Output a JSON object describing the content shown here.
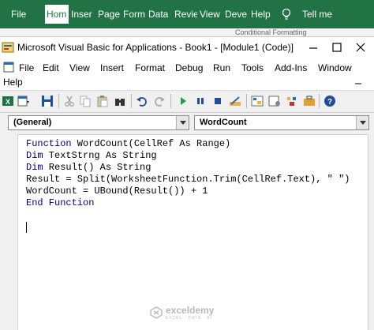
{
  "excel": {
    "tabs": [
      "File",
      "Hom",
      "Inser",
      "Page",
      "Form",
      "Data",
      "Revie",
      "View",
      "Deve",
      "Help"
    ],
    "active_tab_index": 1,
    "tell_me": "Tell me",
    "ribbon_peek": "Conditional Formatting",
    "accent": "#217346"
  },
  "vba": {
    "title": "Microsoft Visual Basic for Applications - Book1 - [Module1 (Code)]",
    "menu_row1": [
      "File",
      "Edit",
      "View",
      "Insert",
      "Format",
      "Debug",
      "Run",
      "Tools",
      "Add-Ins",
      "Window"
    ],
    "menu_row2": [
      "Help"
    ],
    "toolbar_icons": [
      "view-excel-icon",
      "insert-module-icon",
      "save-icon",
      "cut-icon",
      "copy-icon",
      "paste-icon",
      "find-icon",
      "undo-icon",
      "redo-icon",
      "run-icon",
      "break-icon",
      "reset-icon",
      "design-mode-icon",
      "project-explorer-icon",
      "properties-icon",
      "object-browser-icon",
      "toolbox-icon",
      "help-icon"
    ],
    "object_combo": "(General)",
    "procedure_combo": "WordCount",
    "code": [
      {
        "kw": "Function",
        "rest": " WordCount(CellRef As Range)"
      },
      {
        "kw": "Dim",
        "rest": " TextStrng As String"
      },
      {
        "kw": "Dim",
        "rest": " Result() As String"
      },
      {
        "kw": "",
        "rest": "Result = Split(WorksheetFunction.Trim(CellRef.Text), \" \")"
      },
      {
        "kw": "",
        "rest": "WordCount = UBound(Result()) + 1"
      },
      {
        "kw": "End Function",
        "rest": ""
      }
    ],
    "keyword_color": "#00008b"
  },
  "watermark": {
    "name": "exceldemy",
    "tagline": "EXCEL · DATA · BI"
  }
}
